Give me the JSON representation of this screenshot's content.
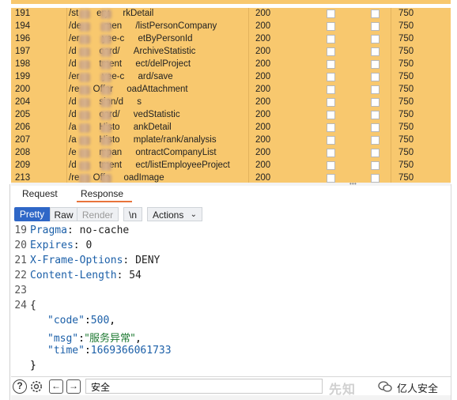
{
  "table": {
    "rows": [
      {
        "num": "191",
        "url": "/st    ery   rkDetail",
        "status": "200",
        "length": "750"
      },
      {
        "num": "194",
        "url": "/de     men   /listPersonCompany",
        "status": "200",
        "length": "750"
      },
      {
        "num": "196",
        "url": "/er     yee-c   etByPersonId",
        "status": "200",
        "length": "750"
      },
      {
        "num": "197",
        "url": "/d     oard/   ArchiveStatistic",
        "status": "200",
        "length": "750"
      },
      {
        "num": "198",
        "url": "/d     tment   ect/delProject",
        "status": "200",
        "length": "750"
      },
      {
        "num": "199",
        "url": "/er     yee-c   ard/save",
        "status": "200",
        "length": "750"
      },
      {
        "num": "200",
        "url": "/re   Offer   oadAttachment",
        "status": "200",
        "length": "750"
      },
      {
        "num": "204",
        "url": "/d     sion/d   s",
        "status": "200",
        "length": "750"
      },
      {
        "num": "205",
        "url": "/d     oard/   vedStatistic",
        "status": "200",
        "length": "750"
      },
      {
        "num": "206",
        "url": "/a     Histo   ankDetail",
        "status": "200",
        "length": "750"
      },
      {
        "num": "207",
        "url": "/a     Histo   mplate/rank/analysis",
        "status": "200",
        "length": "750"
      },
      {
        "num": "208",
        "url": "/e     mpan   ontractCompanyList",
        "status": "200",
        "length": "750"
      },
      {
        "num": "209",
        "url": "/d     tment   ect/listEmployeeProject",
        "status": "200",
        "length": "750"
      },
      {
        "num": "213",
        "url": "/re   Offe   oadImage",
        "status": "200",
        "length": "750"
      }
    ]
  },
  "tabs": {
    "request": "Request",
    "response": "Response"
  },
  "toolbar": {
    "pretty": "Pretty",
    "raw": "Raw",
    "render": "Render",
    "newline": "\\n",
    "actions": "Actions"
  },
  "editor": {
    "lines": [
      {
        "n": "19",
        "key": "Pragma",
        "val": "no-cache"
      },
      {
        "n": "20",
        "key": "Expires",
        "val": "0"
      },
      {
        "n": "21",
        "key": "X-Frame-Options",
        "val": "DENY"
      },
      {
        "n": "22",
        "key": "Content-Length",
        "val": "54"
      },
      {
        "n": "23"
      },
      {
        "n": "24",
        "text": "{"
      }
    ],
    "json": {
      "code_key": "\"code\"",
      "code_val": "500",
      "msg_key": "\"msg\"",
      "msg_val": "\"服务异常\"",
      "time_key": "\"time\"",
      "time_val": "1669366061733",
      "close": "}"
    }
  },
  "bottombar": {
    "search_value": "安全",
    "watermark": "先知",
    "brand": "亿人安全",
    "icons": [
      "help-icon",
      "gear-icon",
      "arrow-left-icon",
      "arrow-right-icon",
      "wechat-icon"
    ]
  },
  "colors": {
    "row_highlight": "#f8c86e",
    "pretty_active": "#2f67c7",
    "response_underline": "#e8743b"
  }
}
